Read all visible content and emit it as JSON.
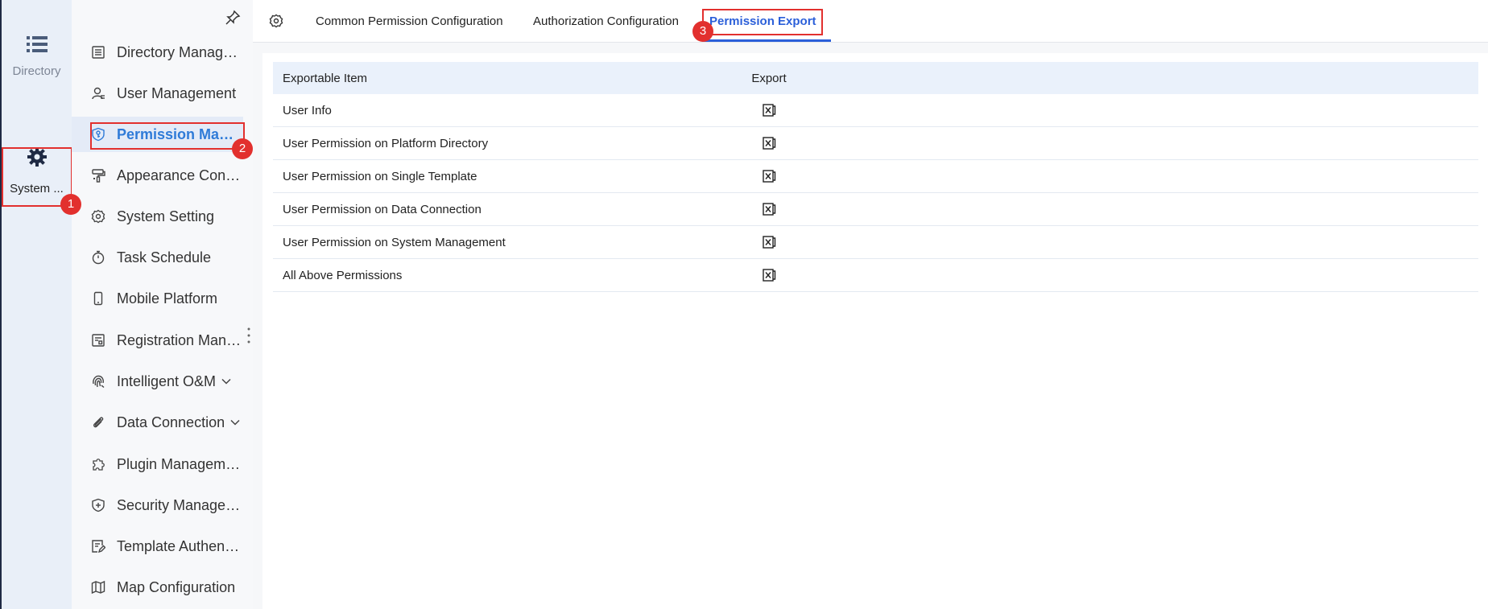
{
  "rail": {
    "directory_label": "Directory",
    "system_label": "System ..."
  },
  "menu": {
    "items": [
      {
        "label": "Directory Management",
        "icon": "list-doc-icon"
      },
      {
        "label": "User Management",
        "icon": "user-icon"
      },
      {
        "label": "Permission Management",
        "icon": "shield-key-icon"
      },
      {
        "label": "Appearance Configuration",
        "icon": "paint-roller-icon"
      },
      {
        "label": "System Setting",
        "icon": "gear-icon"
      },
      {
        "label": "Task Schedule",
        "icon": "stopwatch-icon"
      },
      {
        "label": "Mobile Platform",
        "icon": "mobile-icon"
      },
      {
        "label": "Registration Management",
        "icon": "registration-icon"
      },
      {
        "label": "Intelligent O&M",
        "icon": "fingerprint-icon"
      },
      {
        "label": "Data Connection",
        "icon": "paperclip-icon"
      },
      {
        "label": "Plugin Management",
        "icon": "puzzle-icon"
      },
      {
        "label": "Security Management",
        "icon": "shield-plus-icon"
      },
      {
        "label": "Template Authentication",
        "icon": "template-icon"
      },
      {
        "label": "Map Configuration",
        "icon": "map-icon"
      }
    ]
  },
  "tabs": {
    "items": [
      "Common Permission Configuration",
      "Authorization Configuration",
      "Permission Export"
    ]
  },
  "table": {
    "headers": [
      "Exportable Item",
      "Export"
    ],
    "rows": [
      "User Info",
      "User Permission on Platform Directory",
      "User Permission on Single Template",
      "User Permission on Data Connection",
      "User Permission on System Management",
      "All Above Permissions"
    ]
  },
  "badges": [
    "1",
    "2",
    "3"
  ],
  "colors": {
    "accent": "#2b5fd9",
    "menu_active": "#2f7bd8",
    "highlight": "#e2302e"
  }
}
